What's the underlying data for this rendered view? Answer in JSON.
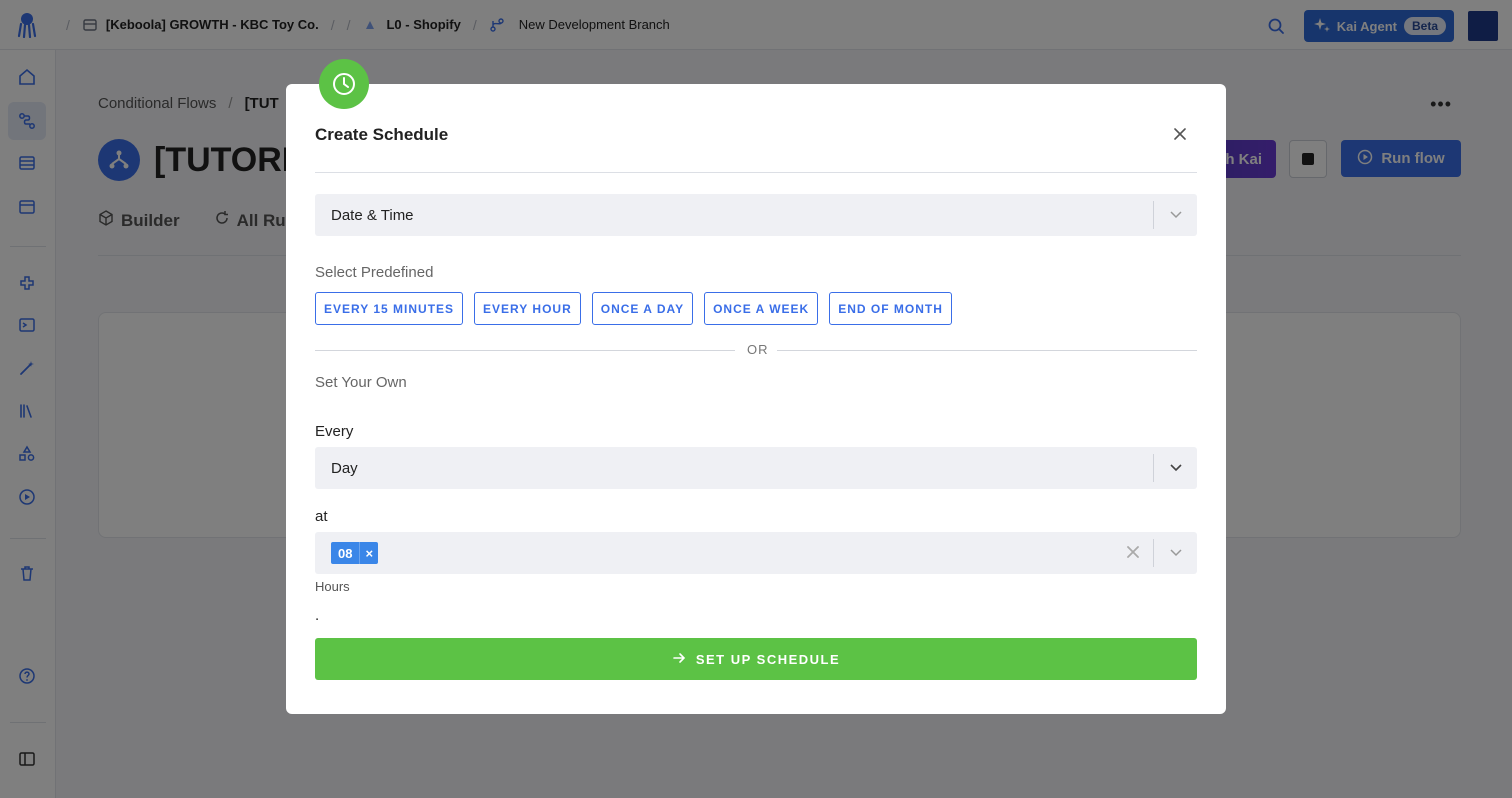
{
  "topbar": {
    "project": "[Keboola] GROWTH - KBC Toy Co.",
    "component": "L0 - Shopify",
    "branch": "New Development Branch",
    "agent_label": "Kai Agent",
    "agent_badge": "Beta"
  },
  "page": {
    "breadcrumb_root": "Conditional Flows",
    "breadcrumb_current": "[TUT",
    "title": "[TUTORIA",
    "kai_button": "h Kai",
    "run_button": "Run flow",
    "tabs": [
      {
        "label": "Builder"
      },
      {
        "label": "All Run"
      }
    ]
  },
  "modal": {
    "title": "Create Schedule",
    "type_select": "Date & Time",
    "predefined_label": "Select Predefined",
    "presets": [
      {
        "label": "EVERY 15 MINUTES"
      },
      {
        "label": "EVERY HOUR"
      },
      {
        "label": "ONCE A DAY"
      },
      {
        "label": "ONCE A WEEK"
      },
      {
        "label": "END OF MONTH"
      }
    ],
    "or_text": "OR",
    "own_label": "Set Your Own",
    "every_label": "Every",
    "every_value": "Day",
    "at_label": "at",
    "hour_tag": "08",
    "hours_hint": "Hours",
    "dot_text": ".",
    "submit_label": "SET UP SCHEDULE"
  },
  "colors": {
    "primary": "#3a6ee8",
    "success": "#5cc245",
    "overlay": "rgba(0,0,0,0.5)"
  }
}
